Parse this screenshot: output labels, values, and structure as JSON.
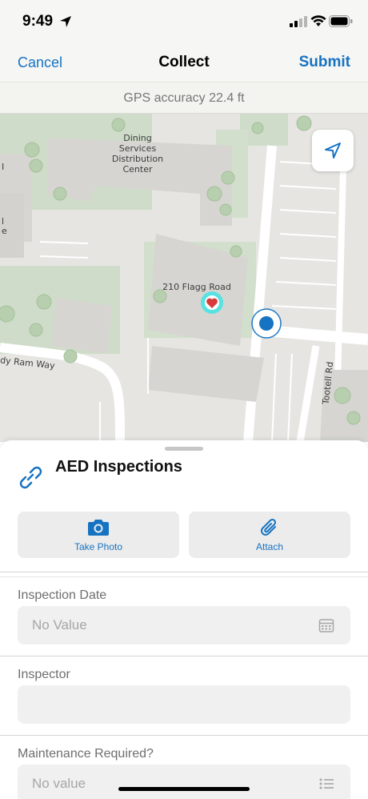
{
  "status_bar": {
    "time": "9:49"
  },
  "nav": {
    "cancel": "Cancel",
    "title": "Collect",
    "submit": "Submit"
  },
  "gps": {
    "text": "GPS accuracy 22.4 ft"
  },
  "map": {
    "labels": {
      "building1": "Dining Services Distribution Center",
      "building2": "210 Flagg Road",
      "street1": "dy Ram Way",
      "street2": "Tootell Rd",
      "edge1": "I",
      "edge2": "l",
      "edge3": "e"
    },
    "colors": {
      "background": "#e6e5e2",
      "building": "#d6d5d1",
      "green": "#c9dac4",
      "road": "#ffffff",
      "marker": "#1673c2",
      "feature_glow": "#2ee6e6",
      "feature_red": "#d93a3a"
    }
  },
  "feature": {
    "layer_title": "AED Inspections"
  },
  "attachments": {
    "take_photo": "Take Photo",
    "attach": "Attach"
  },
  "fields": {
    "inspection_date": {
      "label": "Inspection Date",
      "value": "No Value"
    },
    "inspector": {
      "label": "Inspector",
      "value": ""
    },
    "maintenance_required": {
      "label": "Maintenance Required?",
      "value": "No value"
    }
  },
  "colors": {
    "accent": "#1673c2"
  }
}
